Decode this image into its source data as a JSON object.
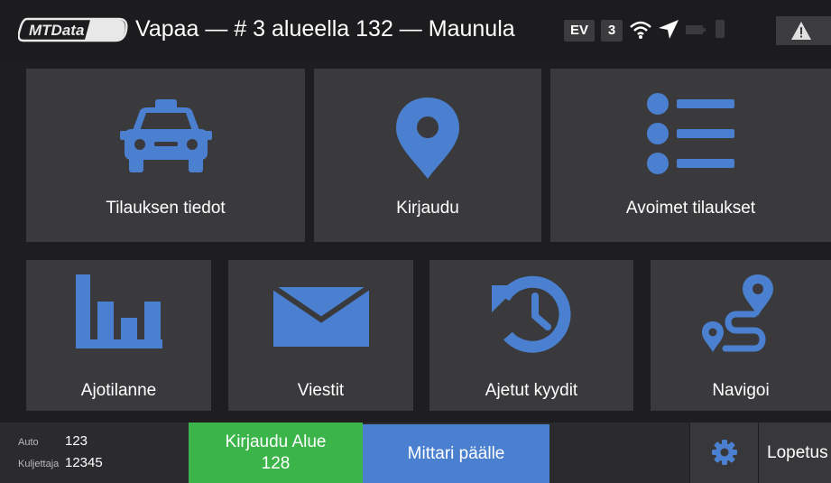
{
  "header": {
    "logo_text": "MTData",
    "title": "Vapaa — # 3 alueella 132 — Maunula",
    "badge_ev": "EV",
    "badge_number": "3",
    "icons": [
      "wifi-icon",
      "location-arrow-icon",
      "battery-icon",
      "plug-icon",
      "warning-icon"
    ]
  },
  "tiles": [
    {
      "label": "Tilauksen tiedot",
      "icon": "taxi-icon"
    },
    {
      "label": "Kirjaudu",
      "icon": "map-pin-icon"
    },
    {
      "label": "Avoimet tilaukset",
      "icon": "list-icon"
    },
    {
      "label": "Ajotilanne",
      "icon": "bar-chart-icon"
    },
    {
      "label": "Viestit",
      "icon": "envelope-icon"
    },
    {
      "label": "Ajetut kyydit",
      "icon": "history-icon"
    },
    {
      "label": "Navigoi",
      "icon": "route-icon"
    }
  ],
  "footer": {
    "auto_label": "Auto",
    "auto_value": "123",
    "driver_label": "Kuljettaja",
    "driver_value": "12345",
    "login_area_line1": "Kirjaudu Alue",
    "login_area_line2": "128",
    "meter_button": "Mittari päälle",
    "logout_button": "Lopetus"
  },
  "colors": {
    "accent_blue": "#4a80cf",
    "green": "#3bb54a",
    "tile_bg": "#3a3a3d",
    "background": "#1e1e20"
  }
}
